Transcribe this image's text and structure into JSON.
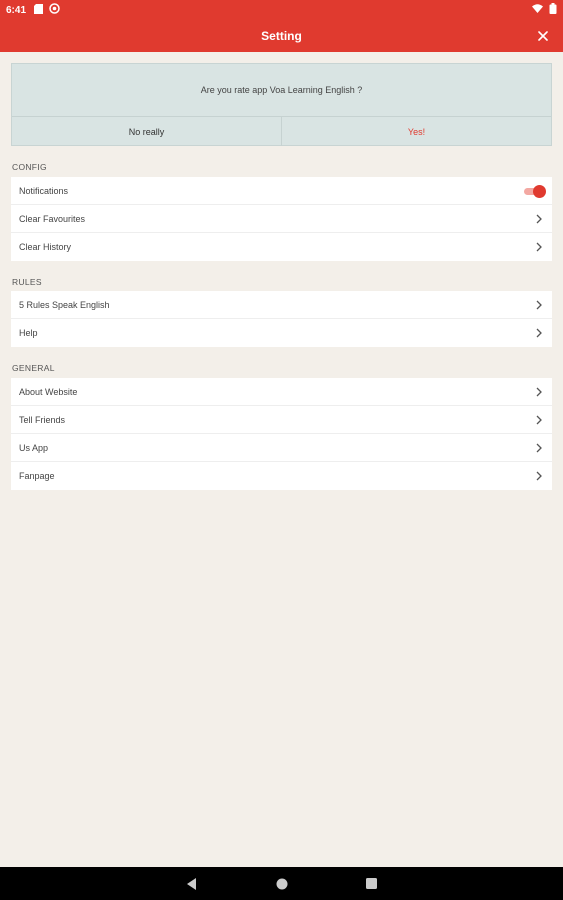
{
  "status_bar": {
    "time": "6:41"
  },
  "app_bar": {
    "title": "Setting"
  },
  "rate": {
    "question": "Are you rate app Voa Learning English ?",
    "no_label": "No really",
    "yes_label": "Yes!"
  },
  "config": {
    "header": "CONFIG",
    "items": [
      {
        "label": "Notifications",
        "type": "toggle",
        "on": true
      },
      {
        "label": "Clear Favourites"
      },
      {
        "label": "Clear History"
      }
    ]
  },
  "rules": {
    "header": "RULES",
    "items": [
      {
        "label": "5 Rules Speak English"
      },
      {
        "label": "Help"
      }
    ]
  },
  "general": {
    "header": "GENERAL",
    "items": [
      {
        "label": "About Website"
      },
      {
        "label": "Tell Friends"
      },
      {
        "label": "Us App"
      },
      {
        "label": "Fanpage"
      }
    ]
  },
  "colors": {
    "accent": "#e03a2f",
    "background": "#f3efe9",
    "rate_card": "#d9e4e3"
  },
  "icons": {
    "close": "close-icon",
    "chevron": "chevron-right-icon",
    "back": "back-icon",
    "home": "home-icon",
    "recents": "recents-icon"
  }
}
